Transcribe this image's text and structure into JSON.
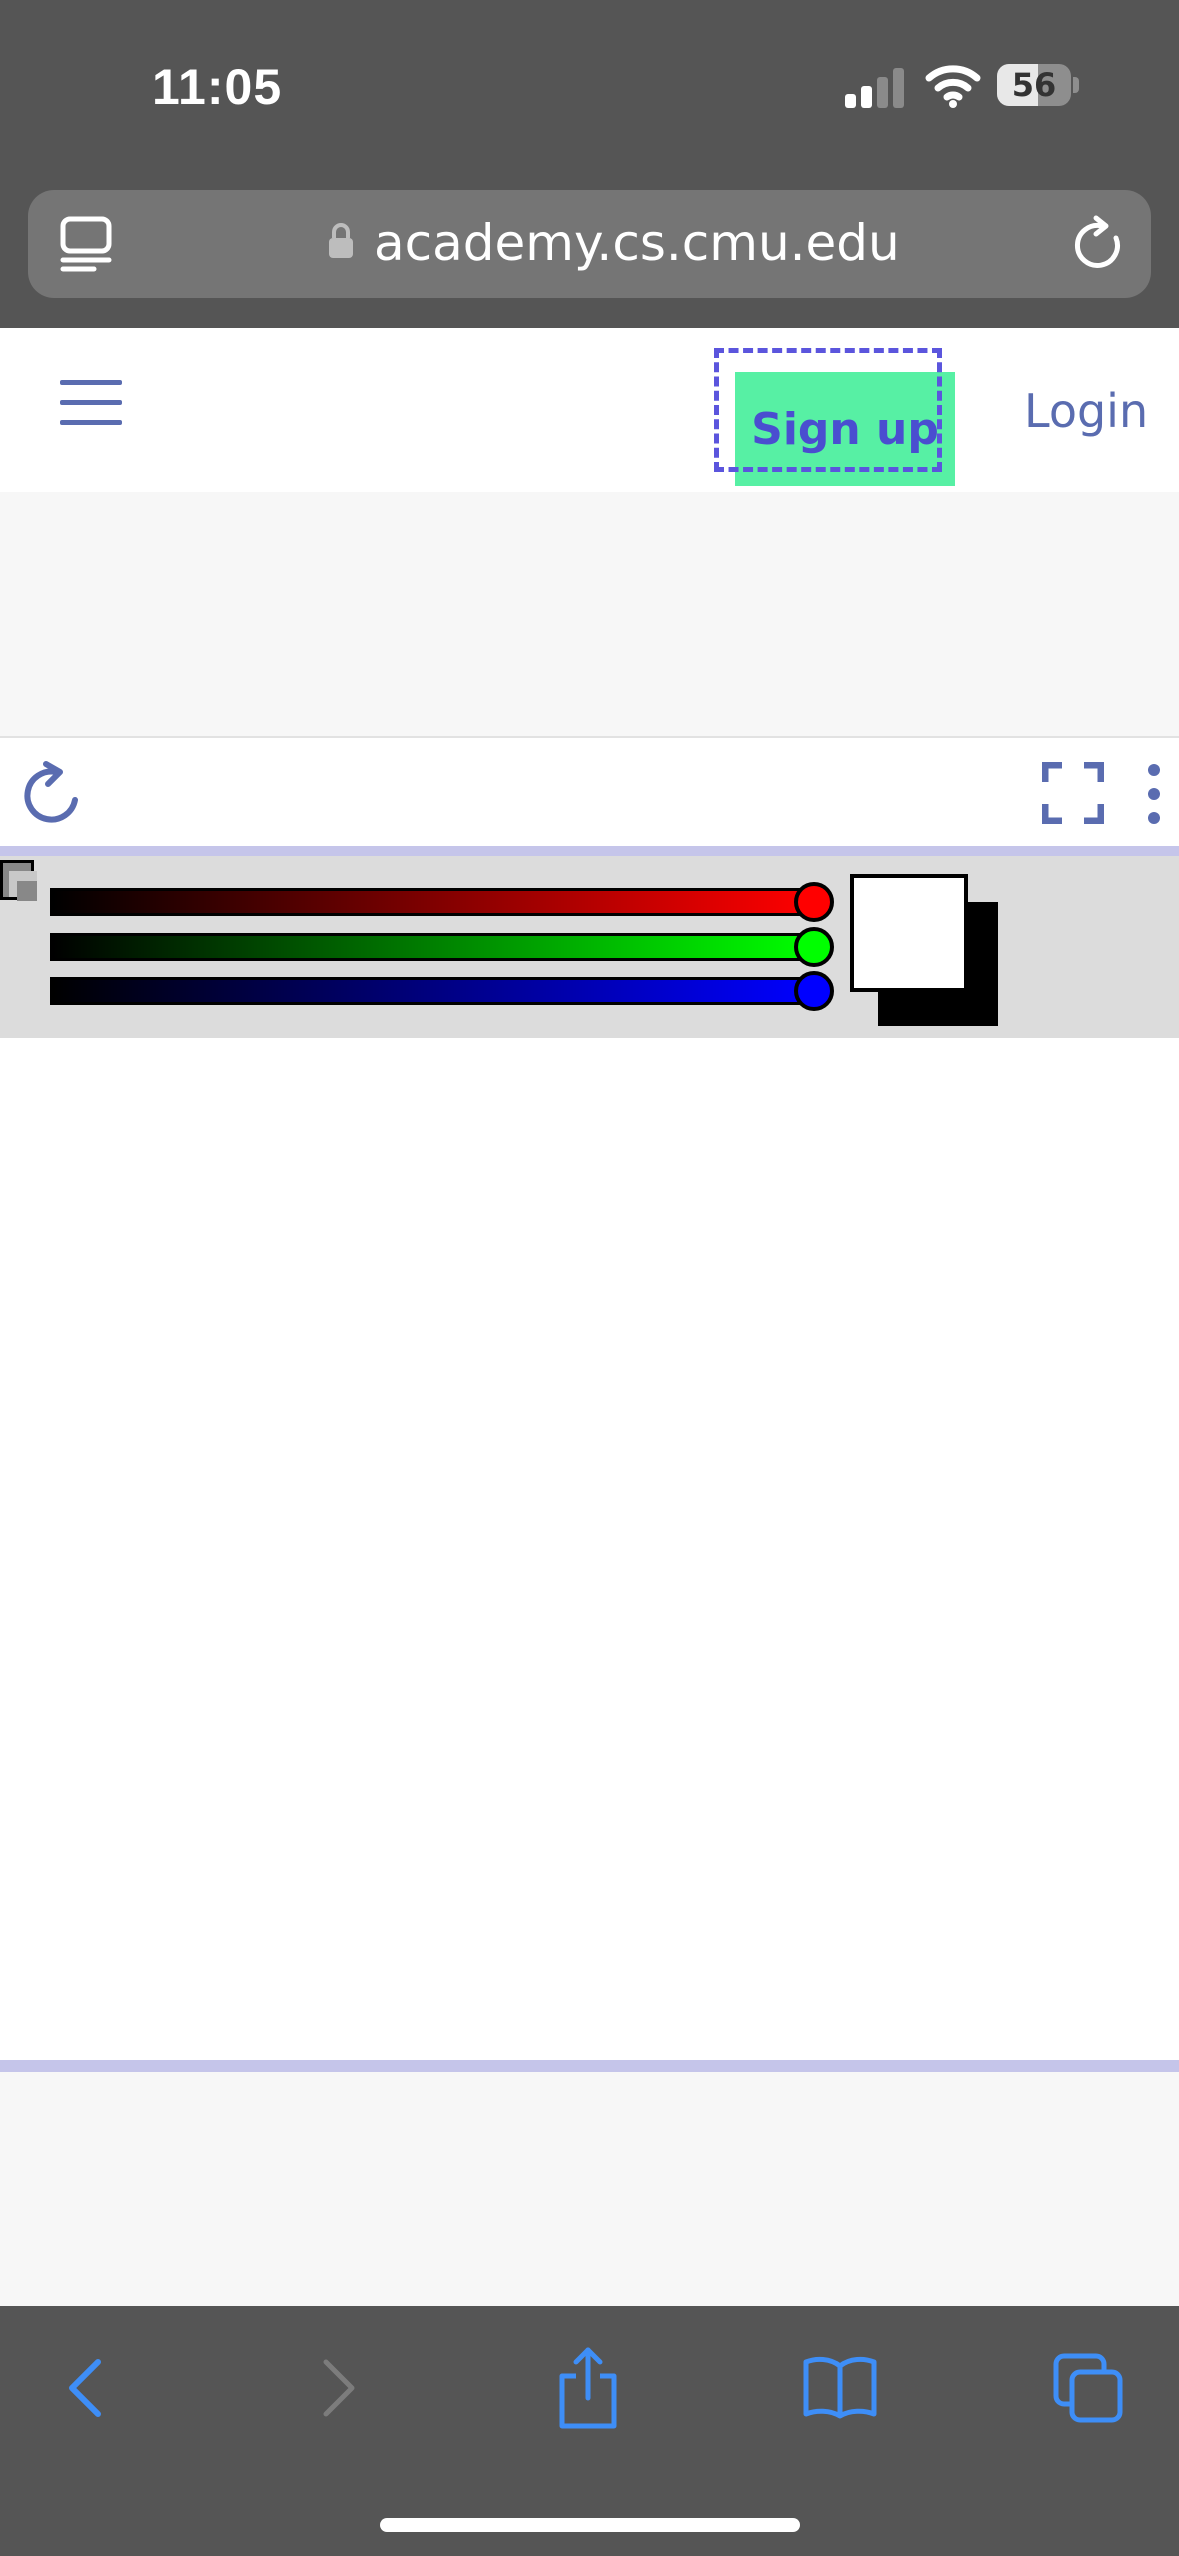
{
  "status_bar": {
    "time": "11:05",
    "battery_level": "56",
    "battery_fraction": 0.56
  },
  "browser": {
    "url": "academy.cs.cmu.edu",
    "icons": [
      "tab-overview-icon",
      "lock-icon",
      "reload-icon"
    ]
  },
  "header": {
    "menu_icon": "hamburger-icon",
    "signup_label": "Sign up",
    "login_label": "Login",
    "colors": {
      "signup_bg": "#57f0a4",
      "signup_text": "#4a4ed0",
      "focus_outline": "#5b55dd",
      "link": "#5a6cb0"
    }
  },
  "toolbar": {
    "icons": [
      "restart-icon",
      "fullscreen-icon",
      "more-vertical-icon"
    ]
  },
  "canvas": {
    "sliders": [
      {
        "name": "red",
        "color": "#ff0000",
        "value_fraction": 1.0
      },
      {
        "name": "green",
        "color": "#00ff00",
        "value_fraction": 1.0
      },
      {
        "name": "blue",
        "color": "#0000ff",
        "value_fraction": 1.0
      }
    ],
    "swatch_color": "#ffffff"
  },
  "bottom_bar": {
    "icons": [
      "back-icon",
      "forward-icon",
      "share-icon",
      "bookmarks-icon",
      "tabs-icon"
    ]
  }
}
